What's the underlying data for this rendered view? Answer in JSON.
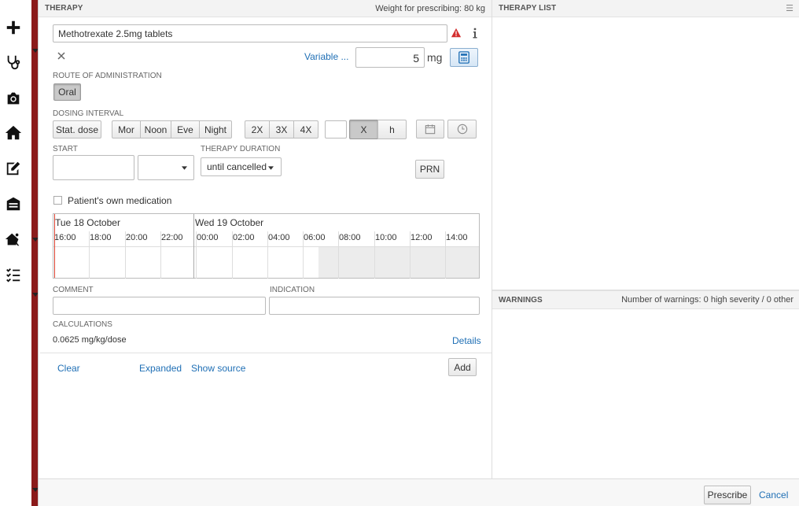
{
  "rail": {
    "icons": [
      "plus-icon",
      "stethoscope-icon",
      "camera-icon",
      "home-icon",
      "signature-icon",
      "inbox-icon",
      "emergency-exit-icon",
      "checklist-icon"
    ]
  },
  "therapy": {
    "header": "THERAPY",
    "weight": "Weight for prescribing: 80 kg",
    "medication": "Methotrexate 2.5mg tablets",
    "variable_link": "Variable ...",
    "dose_value": "5",
    "dose_unit": "mg",
    "route_label": "ROUTE OF ADMINISTRATION",
    "route_option": "Oral",
    "dosing_label": "DOSING INTERVAL",
    "stat_dose": "Stat. dose",
    "times": [
      "Mor",
      "Noon",
      "Eve",
      "Night"
    ],
    "freq": [
      "2X",
      "3X",
      "4X"
    ],
    "x_label": "X",
    "h_label": "h",
    "start_label": "START",
    "duration_label": "THERAPY DURATION",
    "duration_value": "until cancelled",
    "prn": "PRN",
    "own_med": "Patient's own medication",
    "timeline": {
      "day1": "Tue 18 October",
      "day2": "Wed 19 October",
      "hours": [
        "16:00",
        "18:00",
        "20:00",
        "22:00",
        "00:00",
        "02:00",
        "04:00",
        "06:00",
        "08:00",
        "10:00",
        "12:00",
        "14:00"
      ]
    },
    "comment_label": "COMMENT",
    "indication_label": "INDICATION",
    "calc_label": "CALCULATIONS",
    "calc_value": "0.0625 mg/kg/dose",
    "details": "Details",
    "clear": "Clear",
    "expanded": "Expanded",
    "show_source": "Show source",
    "add": "Add"
  },
  "therapy_list": {
    "header": "THERAPY LIST"
  },
  "warnings": {
    "header": "WARNINGS",
    "count": "Number of warnings: 0 high severity / 0 other"
  },
  "footer": {
    "prescribe": "Prescribe",
    "cancel": "Cancel"
  },
  "colors": {
    "link": "#1f6fb5",
    "warning": "#d32f2f",
    "rail_strip": "#8b1b1b"
  }
}
